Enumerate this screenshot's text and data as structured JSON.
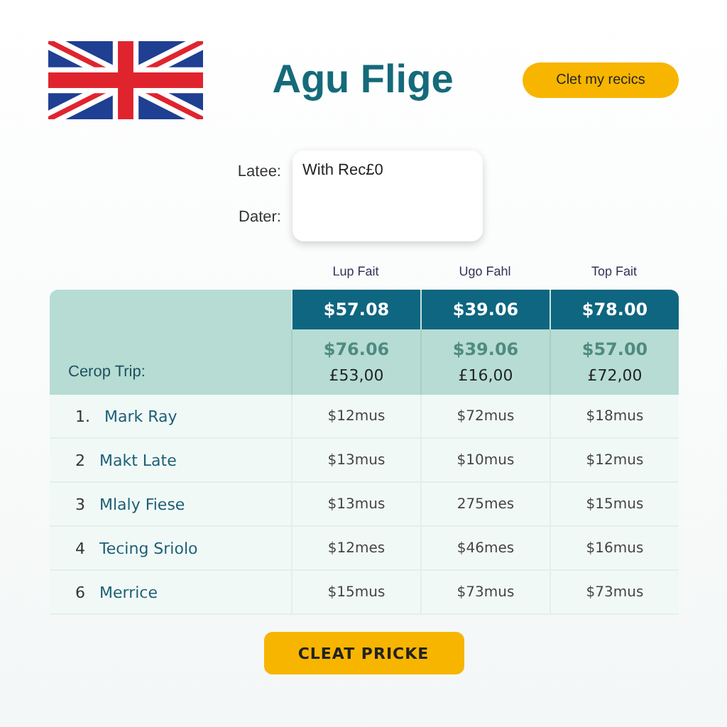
{
  "header": {
    "title": "Agu Flige",
    "action_button": "Clet my recics"
  },
  "form": {
    "labels": [
      "Latee:",
      "Dater:"
    ],
    "value": "With Rec£0"
  },
  "table": {
    "columns": [
      "Lup Fait",
      "Ugo Fahl",
      "Top Fait"
    ],
    "featured_prices": [
      "$57.08",
      "$39.06",
      "$78.00"
    ],
    "faded_prices": [
      "$76.06",
      "$39.06",
      "$57.00"
    ],
    "summary": {
      "label": "Cerop Trip:",
      "values": [
        "£53,00",
        "£16,00",
        "£72,00"
      ]
    },
    "rows": [
      {
        "number": "1.",
        "name": "Mark Ray",
        "values": [
          "$12mus",
          "$72mus",
          "$18mus"
        ]
      },
      {
        "number": "2",
        "name": "Makt Late",
        "values": [
          "$13mus",
          "$10mus",
          "$12mus"
        ]
      },
      {
        "number": "3",
        "name": "Mlaly Fiese",
        "values": [
          "$13mus",
          "275mes",
          "$15mus"
        ]
      },
      {
        "number": "4",
        "name": "Tecing Sriolo",
        "values": [
          "$12mes",
          "$46mes",
          "$16mus"
        ]
      },
      {
        "number": "6",
        "name": "Merrice",
        "values": [
          "$15mus",
          "$73mus",
          "$73mus"
        ]
      }
    ]
  },
  "footer_button": "CLEAT PRICKE"
}
